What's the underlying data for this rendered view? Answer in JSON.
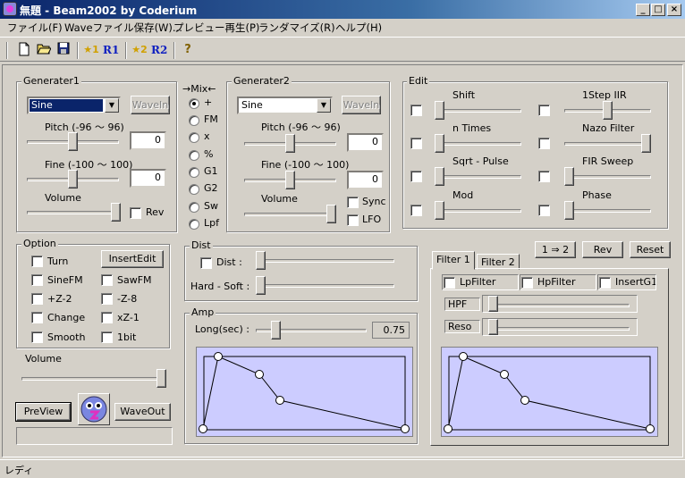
{
  "window": {
    "title": "無題 - Beam2002 by Coderium",
    "min": "_",
    "max": "□",
    "close": "×"
  },
  "menu": [
    "ファイル(F)",
    "Waveファイル保存(W)...",
    "プレビュー再生(P)",
    "ランダマイズ(R)",
    "ヘルプ(H)"
  ],
  "toolbar": {
    "new_icon": "new-icon",
    "open_icon": "open-icon",
    "save_icon": "save-icon",
    "g1_play": "★1",
    "g1_rand": "R1",
    "g2_play": "★2",
    "g2_rand": "R2",
    "help": "?"
  },
  "gen1": {
    "title": "Generater1",
    "wave": "Sine",
    "wavein": "WaveIn",
    "pitch_label": "Pitch (-96 〜 96)",
    "pitch_value": "0",
    "pitch_level": 0.5,
    "fine_label": "Fine (-100 〜 100)",
    "fine_value": "0",
    "fine_level": 0.5,
    "volume_label": "Volume",
    "volume_level": 1.0,
    "rev": "Rev"
  },
  "mix": {
    "title": "→Mix←",
    "options": [
      "+",
      "FM",
      "x",
      "%",
      "G1",
      "G2",
      "Sw",
      "Lpf"
    ],
    "selected": "+"
  },
  "gen2": {
    "title": "Generater2",
    "wave": "Sine",
    "wavein": "WaveIn",
    "pitch_label": "Pitch (-96 〜 96)",
    "pitch_value": "0",
    "pitch_level": 0.5,
    "fine_label": "Fine (-100 〜 100)",
    "fine_value": "0",
    "fine_level": 0.5,
    "volume_label": "Volume",
    "volume_level": 1.0,
    "sync": "Sync",
    "lfo": "LFO"
  },
  "edit": {
    "title": "Edit",
    "left": [
      {
        "label": "Shift",
        "level": 0
      },
      {
        "label": "n Times",
        "level": 0
      },
      {
        "label": "Sqrt - Pulse",
        "level": 0
      },
      {
        "label": "Mod",
        "level": 0
      }
    ],
    "right": [
      {
        "label": "1Step IIR",
        "level": 0.5
      },
      {
        "label": "Nazo Filter",
        "level": 1.0
      },
      {
        "label": "FIR Sweep",
        "level": 0
      },
      {
        "label": "Phase",
        "level": 0
      }
    ]
  },
  "option": {
    "title": "Option",
    "insert_edit": "InsertEdit",
    "items": [
      "Turn",
      "SineFM",
      "SawFM",
      "+Z-2",
      "-Z-8",
      "Change",
      "xZ-1",
      "Smooth",
      "1bit"
    ]
  },
  "volume": {
    "label": "Volume",
    "level": 1.0
  },
  "buttons": {
    "preview": "PreView",
    "waveout": "WaveOut",
    "swap": "1 ⇒ 2",
    "rev": "Rev",
    "reset": "Reset"
  },
  "dist": {
    "title": "Dist",
    "dist_label": "Dist :",
    "dist_level": 0,
    "hardsoft_label": "Hard - Soft :",
    "hardsoft_level": 0
  },
  "amp": {
    "title": "Amp",
    "long_label": "Long(sec) :",
    "long_value": "0.75",
    "long_level": 0.15
  },
  "filter": {
    "tabs": [
      "Filter 1",
      "Filter 2"
    ],
    "lp": "LpFilter",
    "hp": "HpFilter",
    "insert": "InsertG1",
    "hpf_label": "HPF",
    "hpf_level": 0,
    "reso_label": "Reso",
    "reso_level": 0
  },
  "status": {
    "text": "レディ"
  }
}
